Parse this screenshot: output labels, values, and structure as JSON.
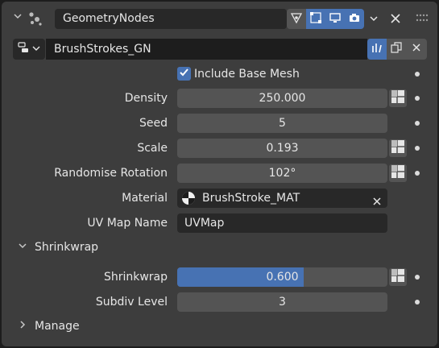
{
  "header": {
    "modifier_name": "GeometryNodes"
  },
  "node_group": {
    "name": "BrushStrokes_GN"
  },
  "properties": {
    "include_base_mesh": {
      "label": "Include Base Mesh",
      "checked": true
    },
    "density": {
      "label": "Density",
      "value": "250.000"
    },
    "seed": {
      "label": "Seed",
      "value": "5"
    },
    "scale": {
      "label": "Scale",
      "value": "0.193"
    },
    "randomise_rotation": {
      "label": "Randomise Rotation",
      "value": "102°"
    },
    "material": {
      "label": "Material",
      "value": "BrushStroke_MAT"
    },
    "uv_map_name": {
      "label": "UV Map Name",
      "value": "UVMap"
    }
  },
  "shrinkwrap_section": {
    "title": "Shrinkwrap",
    "expanded": true,
    "shrinkwrap": {
      "label": "Shrinkwrap",
      "value": "0.600",
      "fraction": 0.6
    },
    "subdiv_level": {
      "label": "Subdiv Level",
      "value": "3"
    }
  },
  "manage_section": {
    "title": "Manage",
    "expanded": false
  },
  "colors": {
    "accent": "#4772b3",
    "panel": "#3d3d3d",
    "field": "#545454"
  }
}
